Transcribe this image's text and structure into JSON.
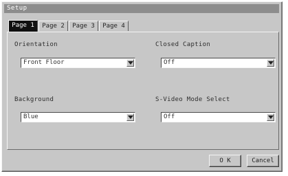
{
  "window": {
    "title": "Setup"
  },
  "tabs": [
    {
      "label": "Page 1",
      "active": true
    },
    {
      "label": "Page 2",
      "active": false
    },
    {
      "label": "Page 3",
      "active": false
    },
    {
      "label": "Page 4",
      "active": false
    }
  ],
  "fields": {
    "orientation": {
      "label": "Orientation",
      "value": "Front Floor"
    },
    "closed_caption": {
      "label": "Closed Caption",
      "value": "Off"
    },
    "background": {
      "label": "Background",
      "value": "Blue"
    },
    "s_video_mode": {
      "label": "S-Video Mode Select",
      "value": "Off"
    }
  },
  "buttons": {
    "ok": "O K",
    "cancel": "Cancel"
  },
  "colors": {
    "active_tab": "#101010",
    "window": "#c7c7c7",
    "titlebar": "#8d8d8d"
  }
}
